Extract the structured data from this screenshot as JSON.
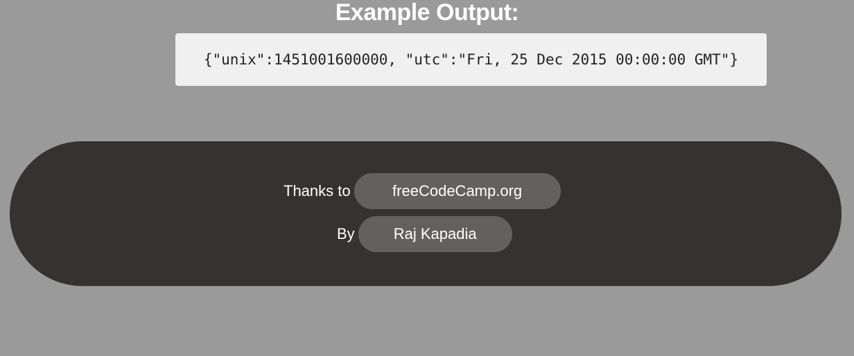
{
  "heading": "Example Output:",
  "example_output": "{\"unix\":1451001600000, \"utc\":\"Fri, 25 Dec 2015 00:00:00 GMT\"}",
  "footer": {
    "thanks_label": "Thanks to",
    "thanks_link": "freeCodeCamp.org",
    "by_label": "By",
    "by_link": "Raj Kapadia"
  },
  "colors": {
    "background": "#9a9a9a",
    "footer_background": "#363232",
    "pill_background": "#656060",
    "code_background": "#f0f0f0"
  }
}
